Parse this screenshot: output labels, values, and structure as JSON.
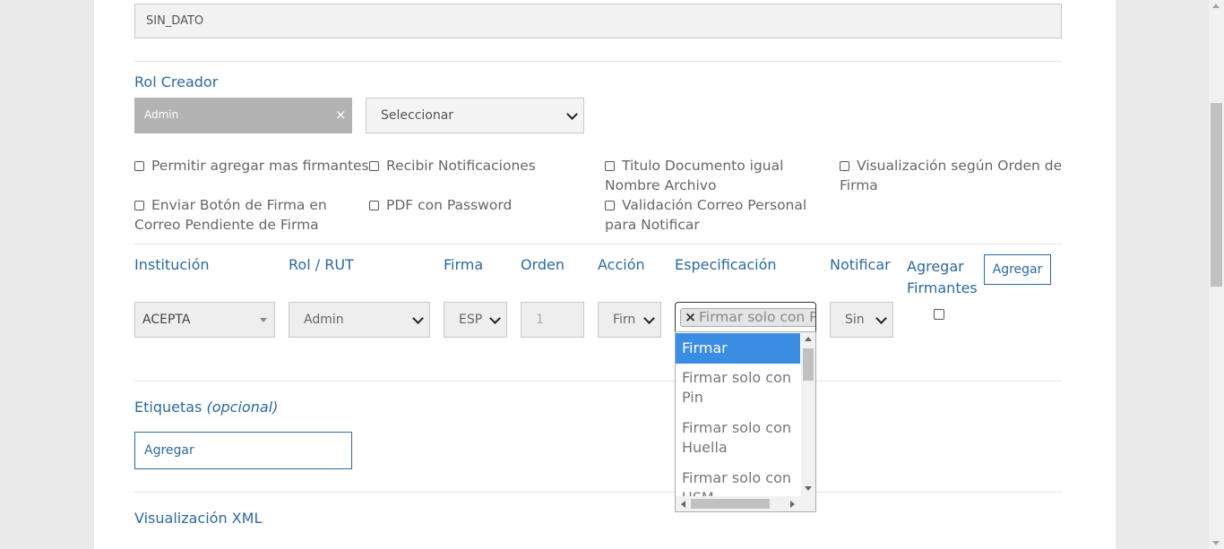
{
  "top_field": {
    "value": "SIN_DATO"
  },
  "rol_creador": {
    "label": "Rol Creador",
    "tag": "Admin",
    "tag_remove": "×",
    "select_value": "Seleccionar"
  },
  "checkboxes": [
    {
      "line1": "Permitir agregar mas firmantes",
      "line2": ""
    },
    {
      "line1": "Recibir Notificaciones",
      "line2": ""
    },
    {
      "line1": "Titulo Documento igual",
      "line2": "Nombre Archivo"
    },
    {
      "line1": "Visualización según Orden de",
      "line2": "Firma"
    },
    {
      "line1": "Enviar Botón de Firma en",
      "line2": "Correo Pendiente de Firma"
    },
    {
      "line1": "PDF con Password",
      "line2": ""
    },
    {
      "line1": "Validación Correo Personal",
      "line2": "para Notificar"
    }
  ],
  "signers": {
    "headers": {
      "institucion": "Institución",
      "rol_rut": "Rol / RUT",
      "firma": "Firma",
      "orden": "Orden",
      "accion": "Acción",
      "especificacion": "Especificación",
      "notificar": "Notificar",
      "agregar_firmantes_1": "Agregar",
      "agregar_firmantes_2": "Firmantes"
    },
    "add_button": "Agregar",
    "row": {
      "institucion": "ACEPTA",
      "rol_rut": "Admin",
      "firma": "ESP",
      "orden_placeholder": "1",
      "accion": "Firn",
      "especificacion_tag": "Firmar solo con Pin",
      "especificacion_remove": "×",
      "notificar": "Sin"
    },
    "dropdown_options": [
      {
        "line1": "Firmar",
        "line2": ""
      },
      {
        "line1": "Firmar solo con",
        "line2": "Pin"
      },
      {
        "line1": "Firmar solo con",
        "line2": "Huella"
      },
      {
        "line1": "Firmar solo con",
        "line2": "USM"
      }
    ]
  },
  "etiquetas": {
    "label": "Etiquetas",
    "label_optional": "(opcional)",
    "input_placeholder": "Agregar"
  },
  "visualizacion_xml": {
    "label": "Visualización XML"
  },
  "colors": {
    "accent": "#2b6aa0",
    "highlight": "#3b8de3",
    "tag_bg": "#b3b3b3",
    "background": "#e9e9e9"
  }
}
